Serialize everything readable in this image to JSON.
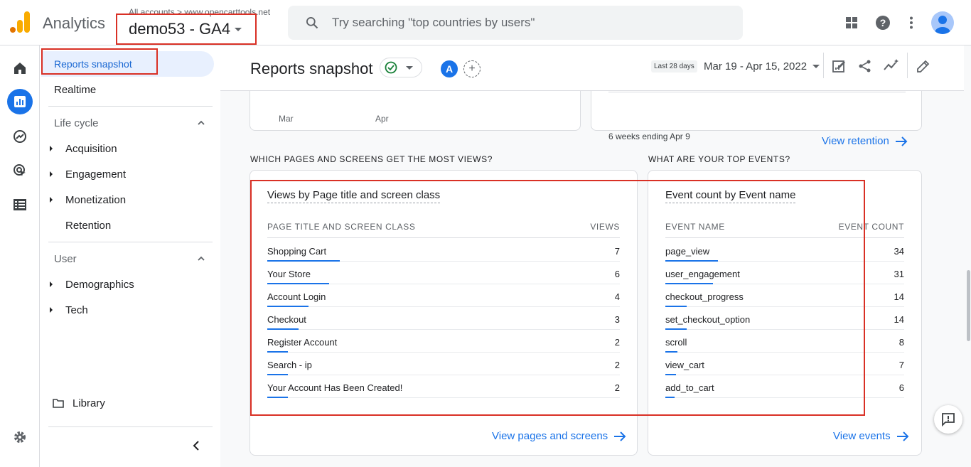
{
  "app": {
    "title": "Analytics"
  },
  "property": {
    "breadcrumb": "All accounts > www.opencarttools.net",
    "name": "demo53 - GA4"
  },
  "search": {
    "placeholder": "Try searching \"top countries by users\""
  },
  "colors": {
    "accent": "#1a73e8",
    "highlight": "#d93025",
    "logo_orange": "#f9ab00",
    "logo_dark": "#e37400"
  },
  "nav": {
    "active": "Reports snapshot",
    "realtime": "Realtime",
    "lifecycle": {
      "heading": "Life cycle",
      "items": [
        "Acquisition",
        "Engagement",
        "Monetization",
        "Retention"
      ]
    },
    "user": {
      "heading": "User",
      "items": [
        "Demographics",
        "Tech"
      ]
    },
    "library": "Library"
  },
  "header": {
    "title": "Reports snapshot",
    "compare_badge": "A",
    "date_chip": "Last 28 days",
    "date_range": "Mar 19 - Apr 15, 2022"
  },
  "top_cards": {
    "left_axis": [
      "Mar",
      "Apr"
    ],
    "retention_caption": "6 weeks ending Apr 9",
    "retention_link": "View retention"
  },
  "pages_card": {
    "section": "WHICH PAGES AND SCREENS GET THE MOST VIEWS?",
    "title": "Views by Page title and screen class",
    "col1": "PAGE TITLE AND SCREEN CLASS",
    "col2": "VIEWS",
    "rows": [
      {
        "label": "Shopping Cart",
        "value": "7"
      },
      {
        "label": "Your Store",
        "value": "6"
      },
      {
        "label": "Account Login",
        "value": "4"
      },
      {
        "label": "Checkout",
        "value": "3"
      },
      {
        "label": "Register Account",
        "value": "2"
      },
      {
        "label": "Search - ip",
        "value": "2"
      },
      {
        "label": "Your Account Has Been Created!",
        "value": "2"
      }
    ],
    "link": "View pages and screens"
  },
  "events_card": {
    "section": "WHAT ARE YOUR TOP EVENTS?",
    "title": "Event count by Event name",
    "col1": "EVENT NAME",
    "col2": "EVENT COUNT",
    "rows": [
      {
        "label": "page_view",
        "value": "34"
      },
      {
        "label": "user_engagement",
        "value": "31"
      },
      {
        "label": "checkout_progress",
        "value": "14"
      },
      {
        "label": "set_checkout_option",
        "value": "14"
      },
      {
        "label": "scroll",
        "value": "8"
      },
      {
        "label": "view_cart",
        "value": "7"
      },
      {
        "label": "add_to_cart",
        "value": "6"
      }
    ],
    "link": "View events"
  }
}
